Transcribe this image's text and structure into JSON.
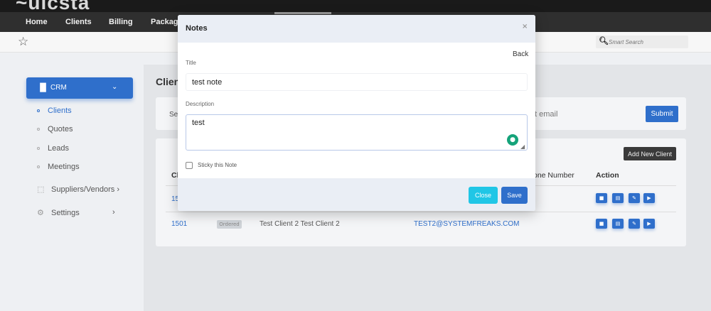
{
  "brand": {
    "logo_text": "~uicsta"
  },
  "topnav": {
    "items": [
      "Home",
      "Clients",
      "Billing",
      "Packages"
    ]
  },
  "subbar": {
    "search_placeholder": "Smart Search"
  },
  "sidebar": {
    "crm_label": "CRM",
    "items": [
      "Clients",
      "Quotes",
      "Leads",
      "Meetings"
    ],
    "suppliers_label": "Suppliers/Vendors",
    "settings_label": "Settings"
  },
  "main": {
    "page_title_partial": "Clien",
    "filter_select_partial": "Sel",
    "email_placeholder_partial": "t email",
    "submit_label": "Submit",
    "add_client_label": "Add New Client",
    "table_headers": {
      "c": "Cl",
      "phone": "one Number",
      "action": "Action"
    },
    "rows": [
      {
        "id_partial": "15",
        "badge": "",
        "name": "",
        "email": ""
      },
      {
        "id": "1501",
        "badge": "Ordered",
        "name": "Test Client 2 Test Client 2",
        "email": "TEST2@SYSTEMFREAKS.COM"
      }
    ]
  },
  "modal": {
    "title": "Notes",
    "close_icon": "×",
    "back_label": "Back",
    "title_label": "Title",
    "title_value": "test note",
    "description_label": "Description",
    "description_value": "test",
    "sticky_label": "Sticky this Note",
    "sticky_checked": false,
    "close_button": "Close",
    "save_button": "Save"
  },
  "colors": {
    "primary": "#2f6fcb",
    "cyan": "#20c6e6",
    "nav_bg": "#2f2f2f"
  }
}
